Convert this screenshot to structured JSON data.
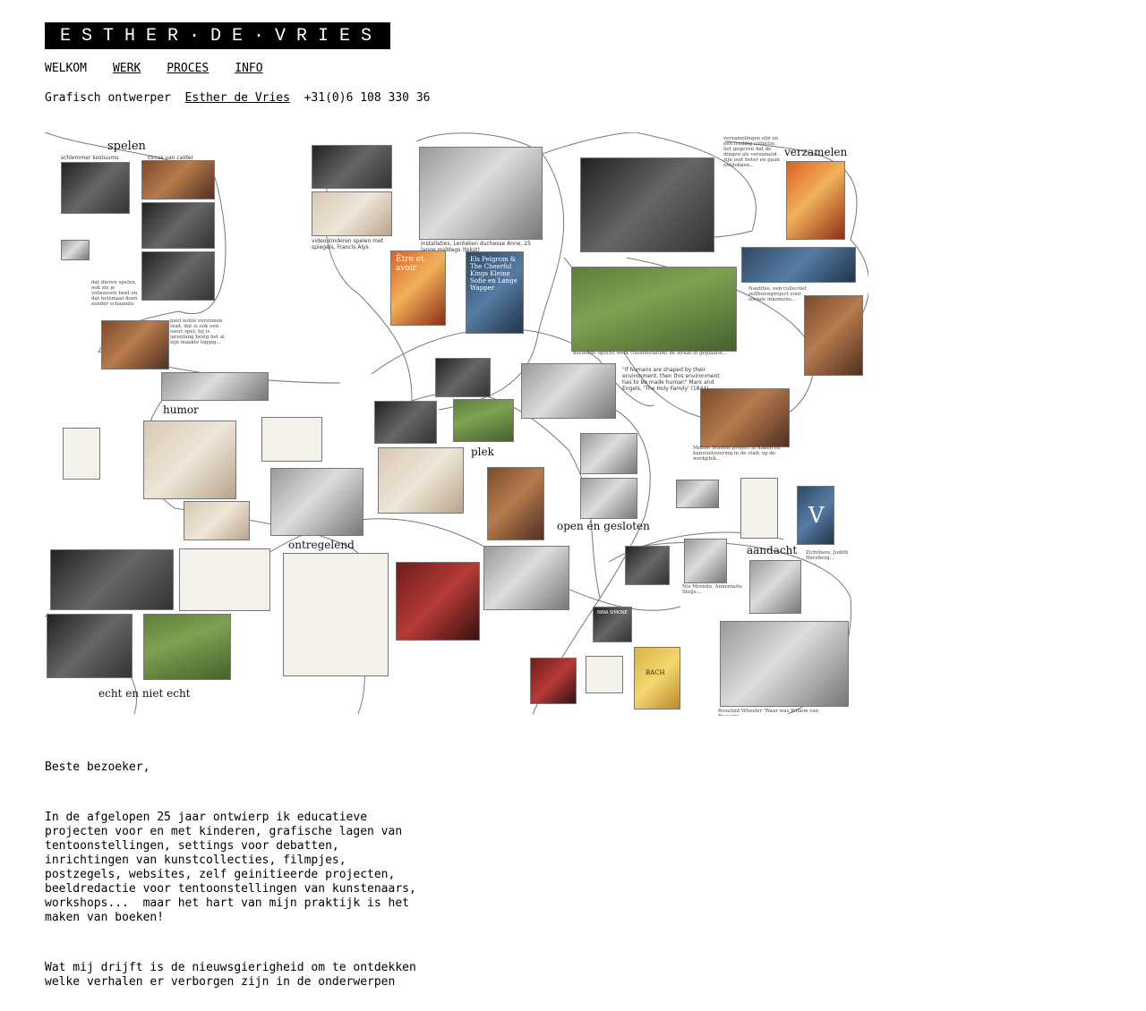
{
  "header": {
    "logo_text": "ESTHER·DE·VRIES",
    "nav": [
      {
        "label": "WELKOM",
        "underlined": false
      },
      {
        "label": "WERK",
        "underlined": true
      },
      {
        "label": "PROCES",
        "underlined": true
      },
      {
        "label": "INFO",
        "underlined": true
      }
    ],
    "tagline_prefix": "Grafisch ontwerper",
    "tagline_name": "Esther de Vries",
    "tagline_phone": "+31(0)6 108 330 36"
  },
  "collage": {
    "labels": [
      "spelen",
      "verzamelen",
      "humor",
      "plek",
      "open én gesloten",
      "ontregelend",
      "aandacht",
      "echt en niet echt"
    ],
    "captions": {
      "schlemmer": "schlemmer kostuums",
      "calder": "circus van calder",
      "video": "video kinderen spelen met spiegels, Francis Alys",
      "brooker": "Installaties, Lenteken duchesse Anne, 25 lange middags (tekst)",
      "motto": "\"if humans are shaped by their environment, then this environment has to be made human\" Marx and Engels, 'The Holy Family' (1844)",
      "bach": "BACH",
      "nina": "NINA SIMONE",
      "etre": "Être et avoir",
      "elspel": "Els Pelgrom & The Cheerful Kings Kleine Sofie en Lange Wapper",
      "v": "V"
    }
  },
  "letter": {
    "greeting": "Beste bezoeker,",
    "p1": "In de afgelopen 25 jaar ontwierp ik educatieve\nprojecten voor en met kinderen, grafische lagen van\ntentoonstellingen, settings voor debatten,\ninrichtingen van kunstcollecties, filmpjes,\npostzegels, websites, zelf geinitieerde projecten,\nbeeldredactie voor tentoonstellingen van kunstenaars,\nworkshops...  maar het hart van mijn praktijk is het\nmaken van boeken!",
    "p2": "Wat mij drijft is de nieuwsgierigheid om te ontdekken\nwelke verhalen er verborgen zijn in de onderwerpen"
  }
}
